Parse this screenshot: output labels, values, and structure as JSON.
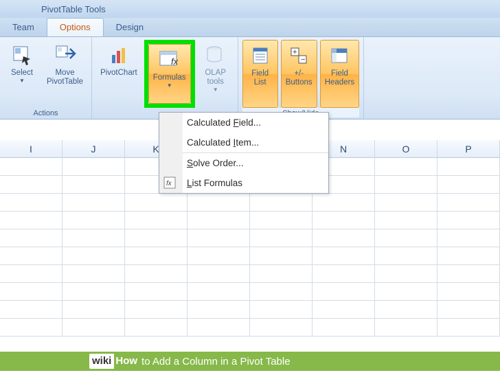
{
  "title_bar": {
    "title": "PivotTable Tools"
  },
  "tabs": {
    "team": "Team",
    "options": "Options",
    "design": "Design"
  },
  "ribbon": {
    "actions": {
      "select": "Select",
      "move": "Move\nPivotTable",
      "label": "Actions"
    },
    "tools": {
      "pivotchart": "PivotChart",
      "formulas": "Formulas",
      "olap": "OLAP\ntools"
    },
    "showhide": {
      "fieldlist": "Field\nList",
      "buttons": "+/-\nButtons",
      "fieldheaders": "Field\nHeaders",
      "label": "Show/Hide"
    }
  },
  "dropdown": {
    "calc_field": "Calculated Field...",
    "calc_item": "Calculated Item...",
    "solve_order": "Solve Order...",
    "list_formulas": "List Formulas"
  },
  "columns": [
    "I",
    "J",
    "K",
    "",
    "",
    "N",
    "O",
    "P"
  ],
  "footer": {
    "wiki": "wiki",
    "how": "How",
    "text": " to Add a Column in a Pivot Table"
  }
}
